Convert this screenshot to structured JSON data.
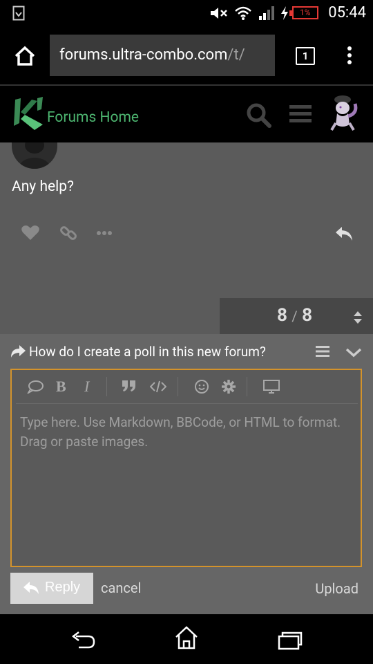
{
  "status_bar": {
    "battery_percent": "1%",
    "time": "05:44"
  },
  "browser": {
    "url_host": "forums.ultra-combo.com",
    "url_path": "/t/",
    "tab_count": "1"
  },
  "site_header": {
    "home_label": "Forums Home",
    "logo_text": "KI"
  },
  "post": {
    "text": "Any help?"
  },
  "progress": {
    "current": "8",
    "separator": "/",
    "total": "8"
  },
  "composer": {
    "topic_title": "How do I create a poll in this new forum?",
    "placeholder": "Type here. Use Markdown, BBCode, or HTML to format. Drag or paste images.",
    "bold_label": "B",
    "italic_label": "I",
    "reply_label": "Reply",
    "cancel_label": "cancel",
    "upload_label": "Upload"
  },
  "colors": {
    "accent_border": "#d4932b",
    "brand_green": "#4db570",
    "battery_low": "#e53935"
  }
}
